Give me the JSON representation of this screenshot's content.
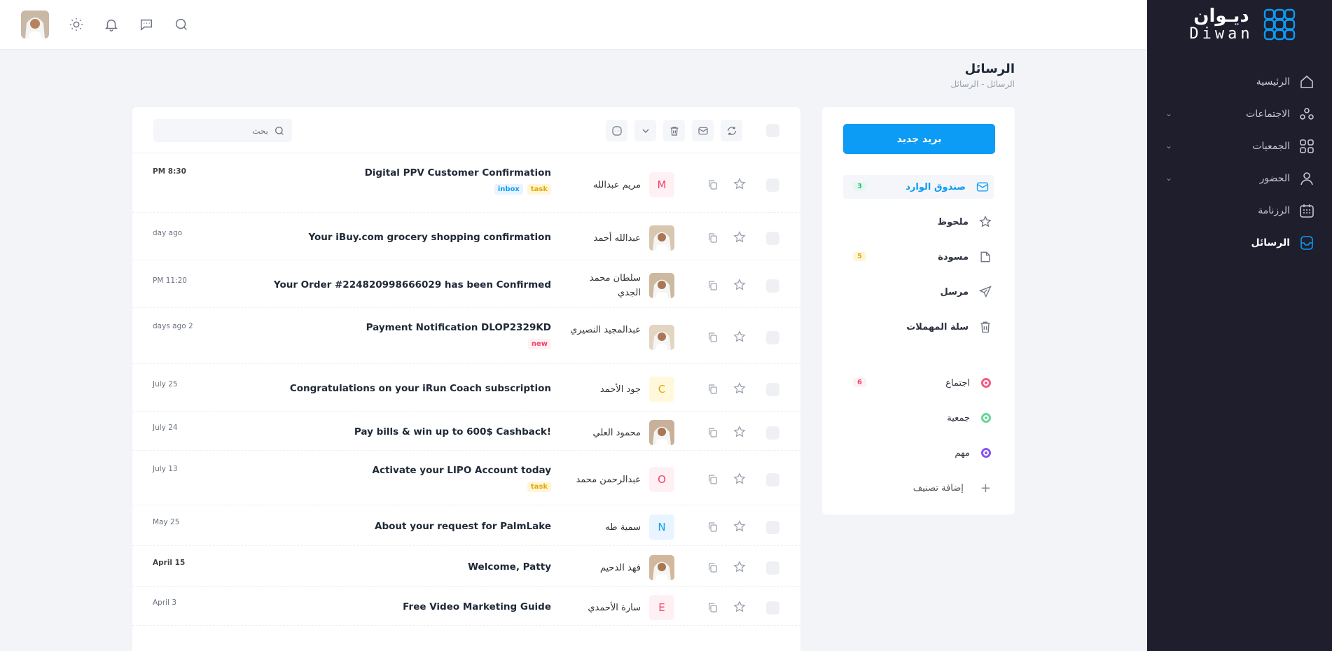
{
  "brand": {
    "name_ar": "ديـوان",
    "name_en": "Diwan"
  },
  "colors": {
    "accent": "#0d9cf5",
    "sidebar": "#1e1e2d"
  },
  "nav": [
    {
      "label": "الرئيسية",
      "icon": "home-icon",
      "chevron": false
    },
    {
      "label": "الاجتماعات",
      "icon": "meetings-icon",
      "chevron": true
    },
    {
      "label": "الجمعيات",
      "icon": "associations-icon",
      "chevron": true
    },
    {
      "label": "الحضور",
      "icon": "user-icon",
      "chevron": true
    },
    {
      "label": "الرزنامة",
      "icon": "calendar-icon",
      "chevron": false
    },
    {
      "label": "الرسائل",
      "icon": "messages-icon",
      "chevron": false,
      "active": true
    }
  ],
  "topbar": {
    "icons": [
      "search-icon",
      "chat-icon",
      "bell-icon",
      "sun-icon"
    ]
  },
  "page": {
    "title": "الرسائل",
    "breadcrumb": "الرسائل  -  الرسائل"
  },
  "folders": {
    "new_mail": "بريد جديد",
    "items": [
      {
        "label": "صندوق الوارد",
        "count": "3",
        "count_bg": "#e6f7ef",
        "count_color": "#1bc57c",
        "active": true
      },
      {
        "label": "ملحوظ",
        "count": ""
      },
      {
        "label": "مسودة",
        "count": "5",
        "count_bg": "#fff6d9",
        "count_color": "#e3a800"
      },
      {
        "label": "مرسل",
        "count": ""
      },
      {
        "label": "سلة المهملات",
        "count": ""
      }
    ],
    "labels": [
      {
        "label": "اجتماع",
        "color": "#f1416c",
        "count": "6"
      },
      {
        "label": "جمعية",
        "color": "#50cd89",
        "count": ""
      },
      {
        "label": "مهم",
        "color": "#7239ea",
        "count": ""
      }
    ],
    "add_label": "إضافة تصنيف"
  },
  "search": {
    "placeholder": "بحث"
  },
  "messages": [
    {
      "sender": "مريم عبدالله",
      "avatar_letter": "M",
      "avatar_bg": "#fff0f3",
      "avatar_color": "#f1416c",
      "subject": "Digital PPV Customer Confirmation",
      "tags": [
        {
          "t": "inbox",
          "bg": "#e8f4ff",
          "c": "#0d9cf5"
        },
        {
          "t": "task",
          "bg": "#fff6d9",
          "c": "#e3a800"
        }
      ],
      "time": "PM 8:30",
      "time_dark": true
    },
    {
      "sender": "عبدالله أحمد",
      "avatar_letter": "",
      "subject": "Your iBuy.com grocery shopping confirmation",
      "tags": [],
      "time": "day ago",
      "time_dark": false
    },
    {
      "sender": "سلطان محمد الجدي",
      "avatar_letter": "",
      "subject": "Your Order #224820998666029 has been Confirmed",
      "tags": [],
      "time": "PM 11:20",
      "time_dark": false
    },
    {
      "sender": "عبدالمجيد النصيري",
      "avatar_letter": "",
      "subject": "Payment Notification DLOP2329KD",
      "tags": [
        {
          "t": "new",
          "bg": "#fff0f3",
          "c": "#f1416c"
        }
      ],
      "time": "days ago 2",
      "time_dark": false
    },
    {
      "sender": "جود الأحمد",
      "avatar_letter": "C",
      "avatar_bg": "#fff8dd",
      "avatar_color": "#e3a800",
      "subject": "Congratulations on your iRun Coach subscription",
      "tags": [],
      "time": "July 25",
      "time_dark": false
    },
    {
      "sender": "محمود العلي",
      "avatar_letter": "",
      "subject": "Pay bills & win up to 600$ Cashback!",
      "tags": [],
      "time": "July 24",
      "time_dark": false
    },
    {
      "sender": "عبدالرحمن محمد",
      "avatar_letter": "O",
      "avatar_bg": "#fff0f3",
      "avatar_color": "#f1416c",
      "subject": "Activate your LIPO Account today",
      "tags": [
        {
          "t": "task",
          "bg": "#fff6d9",
          "c": "#e3a800"
        }
      ],
      "time": "July 13",
      "time_dark": false
    },
    {
      "sender": "سمية طه",
      "avatar_letter": "N",
      "avatar_bg": "#e8f4ff",
      "avatar_color": "#0d9cf5",
      "subject": "About your request for PalmLake",
      "tags": [],
      "time": "May 25",
      "time_dark": false
    },
    {
      "sender": "فهد الدحيم",
      "avatar_letter": "",
      "subject": "Welcome, Patty",
      "tags": [],
      "time": "April 15",
      "time_dark": true
    },
    {
      "sender": "سارة الأحمدي",
      "avatar_letter": "E",
      "avatar_bg": "#fff0f3",
      "avatar_color": "#f1416c",
      "subject": "Free Video Marketing Guide",
      "tags": [],
      "time": "April 3",
      "time_dark": false
    }
  ]
}
